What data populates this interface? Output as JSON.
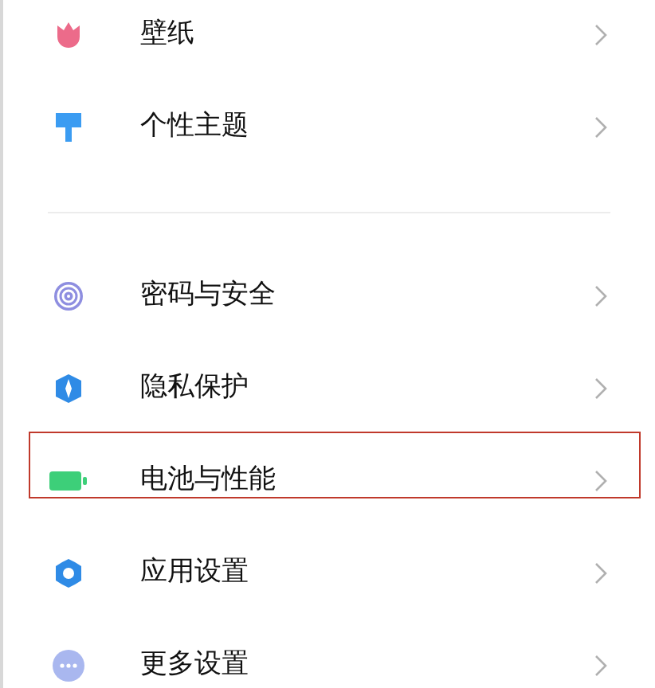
{
  "sections": [
    {
      "items": [
        {
          "kind": "wallpaper",
          "label": "壁纸",
          "highlighted": false
        },
        {
          "kind": "theme",
          "label": "个性主题",
          "highlighted": false
        }
      ]
    },
    {
      "items": [
        {
          "kind": "password",
          "label": "密码与安全",
          "highlighted": false
        },
        {
          "kind": "privacy",
          "label": "隐私保护",
          "highlighted": false
        },
        {
          "kind": "battery",
          "label": "电池与性能",
          "highlighted": true
        },
        {
          "kind": "apps",
          "label": "应用设置",
          "highlighted": false
        },
        {
          "kind": "more",
          "label": "更多设置",
          "highlighted": false
        }
      ]
    }
  ]
}
